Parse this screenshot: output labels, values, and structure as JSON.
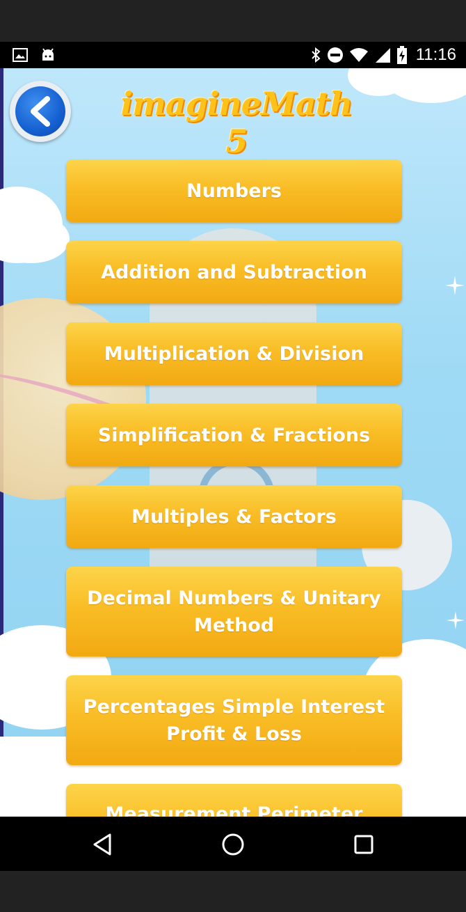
{
  "status_bar": {
    "time": "11:16",
    "left_icons": [
      "image-icon",
      "android-icon"
    ],
    "right_icons": [
      "bluetooth-icon",
      "do-not-disturb-icon",
      "wifi-icon",
      "signal-icon",
      "battery-charging-icon"
    ]
  },
  "header": {
    "title": "imagineMath 5",
    "back_icon": "chevron-left-icon"
  },
  "menu": {
    "items": [
      {
        "label": "Numbers"
      },
      {
        "label": "Addition and Subtraction"
      },
      {
        "label": "Multiplication & Division"
      },
      {
        "label": "Simplification & Fractions"
      },
      {
        "label": "Multiples & Factors"
      },
      {
        "label": "Decimal Numbers & Unitary Method"
      },
      {
        "label": "Percentages Simple Interest Profit & Loss"
      },
      {
        "label": "Measurement Perimeter"
      }
    ]
  },
  "nav_bar": {
    "icons": [
      "back-triangle-icon",
      "home-circle-icon",
      "recents-square-icon"
    ]
  },
  "colors": {
    "button_top": "#fdd44a",
    "button_bottom": "#f2a912",
    "title": "#ffc21b",
    "background": "#9fdaf5",
    "back_button": "#1560d0"
  }
}
